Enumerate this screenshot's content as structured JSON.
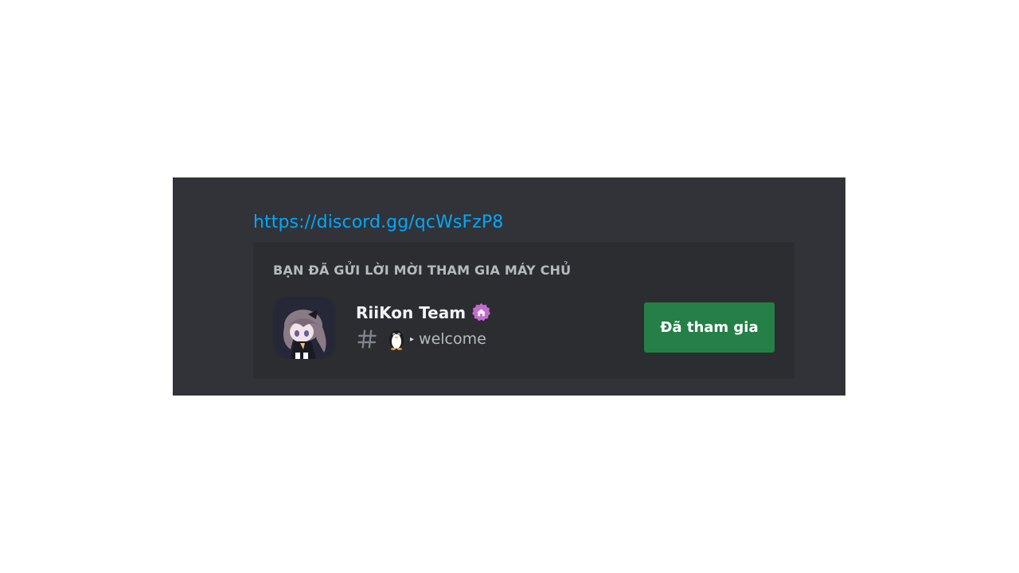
{
  "message": {
    "invite_link": "https://discord.gg/qcWsFzP8"
  },
  "invite_card": {
    "header": "BẠN ĐÃ GỬI LỜI MỜI THAM GIA MÁY CHỦ",
    "server_name": "RiiKon Team",
    "badge_icon": "partner-badge-icon",
    "channel": {
      "icon": "hash-icon",
      "emoji": "penguin-icon",
      "separator": "▸",
      "name": "welcome"
    },
    "join_button_label": "Đã tham gia"
  },
  "colors": {
    "background": "#313338",
    "card": "#2b2d31",
    "link": "#00a8fc",
    "button": "#248046",
    "badge": "#c36bd1"
  }
}
